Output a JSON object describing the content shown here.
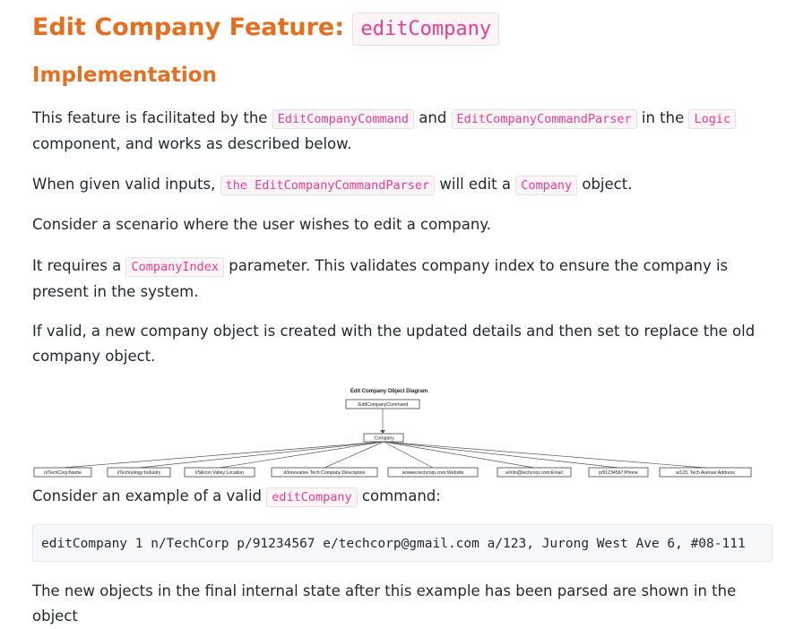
{
  "heading": {
    "title": "Edit Company Feature:",
    "code": "editCompany"
  },
  "subheading": "Implementation",
  "p1": {
    "t1": "This feature is facilitated by the ",
    "c1": "EditCompanyCommand",
    "t2": " and ",
    "c2": "EditCompanyCommandParser",
    "t3": " in the ",
    "c3": "Logic",
    "t4": " component, and works as described below."
  },
  "p2": {
    "t1": "When given valid inputs, ",
    "c1": "the EditCompanyCommandParser",
    "t2": " will edit a ",
    "c2": "Company",
    "t3": " object."
  },
  "p3": "Consider a scenario where the user wishes to edit a company.",
  "p4": {
    "t1": "It requires a ",
    "c1": "CompanyIndex",
    "t2": " parameter. This validates company index to ensure the company is present in the system."
  },
  "p5": "If valid, a new company object is created with the updated details and then set to replace the old company object.",
  "diagram": {
    "title": "Edit Company Object Diagram",
    "root": ":EditCompanyCommand",
    "center": ":Company",
    "children": [
      "n/TechCorp:Name",
      "i/Technology:Industry",
      "l/Silicon Valley:Location",
      "d/Innovative Tech Company:Description",
      "w/www.techcorp.com:Website",
      "e/info@techcorp.com:Email",
      "p/91234567:Phone",
      "a/123, Tech Avenue:Address"
    ]
  },
  "p6": {
    "t1": "Consider an example of a valid ",
    "c1": "editCompany",
    "t2": " command:"
  },
  "code_example": "editCompany 1 n/TechCorp p/91234567 e/techcorp@gmail.com a/123, Jurong West Ave 6, #08-111",
  "p7": "The new objects in the final internal state after this example has been parsed are shown in the object"
}
